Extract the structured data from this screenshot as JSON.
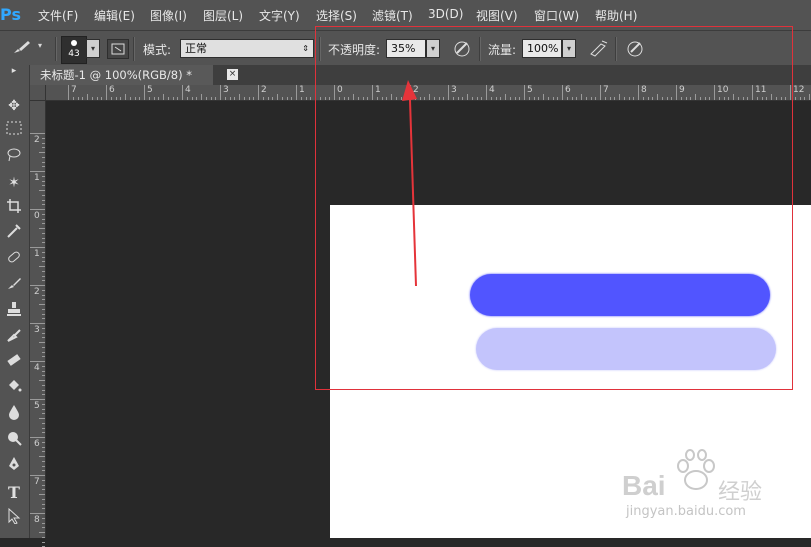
{
  "app": {
    "logo": "Ps"
  },
  "menu": {
    "items": [
      "文件(F)",
      "编辑(E)",
      "图像(I)",
      "图层(L)",
      "文字(Y)",
      "选择(S)",
      "滤镜(T)",
      "3D(D)",
      "视图(V)",
      "窗口(W)",
      "帮助(H)"
    ]
  },
  "options": {
    "brush_size": "43",
    "mode_label": "模式:",
    "mode_value": "正常",
    "opacity_label": "不透明度:",
    "opacity_value": "35%",
    "flow_label": "流量:",
    "flow_value": "100%"
  },
  "document": {
    "tab_title": "未标题-1 @ 100%(RGB/8) *",
    "close_glyph": "×"
  },
  "ruler": {
    "horizontal": [
      "7",
      "6",
      "5",
      "4",
      "3",
      "2",
      "1",
      "0",
      "1",
      "2",
      "3",
      "4",
      "5",
      "6",
      "7",
      "8",
      "9",
      "10",
      "11",
      "12"
    ],
    "vertical": [
      "2",
      "1",
      "0",
      "1",
      "2",
      "3",
      "4",
      "5",
      "6",
      "7",
      "8"
    ]
  },
  "canvas": {
    "stroke_full_color": "#5155ff",
    "stroke_light_color": "#c3c4fc",
    "stroke_light_opacity": 0.35
  },
  "annotation": {
    "highlight_color": "#e0323b",
    "arrow_color": "#e5343a"
  },
  "watermark": {
    "brand": "Bai",
    "brand_suffix": "经验",
    "url": "jingyan.baidu.com"
  },
  "icons": {
    "brush": "brush-icon",
    "pressure_opacity": "pressure-opacity-icon",
    "airbrush": "airbrush-icon",
    "pressure_size": "pressure-size-icon"
  }
}
